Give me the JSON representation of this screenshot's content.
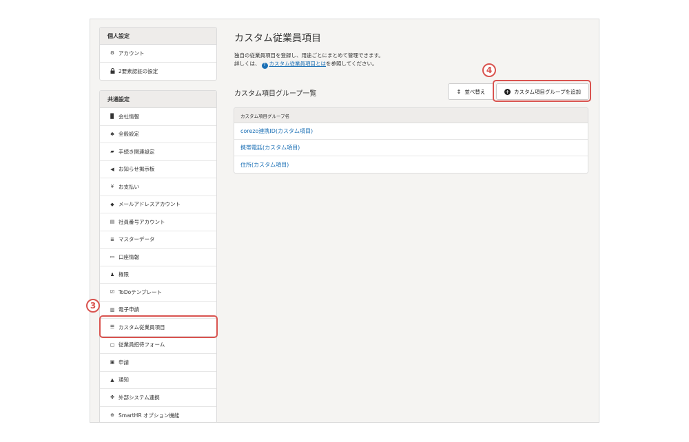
{
  "sidebar": {
    "personal": {
      "title": "個人設定",
      "items": [
        {
          "icon": "gear-icon",
          "glyph": "✿",
          "label": "アカウント"
        },
        {
          "icon": "lock-icon",
          "glyph": "🔒",
          "label": "2要素認証の設定"
        }
      ]
    },
    "common": {
      "title": "共通設定",
      "items": [
        {
          "icon": "building-icon",
          "glyph": "▉",
          "label": "会社情報"
        },
        {
          "icon": "star-icon",
          "glyph": "✱",
          "label": "全般設定"
        },
        {
          "icon": "procedure-icon",
          "glyph": "▰",
          "label": "手続き関連設定"
        },
        {
          "icon": "megaphone-icon",
          "glyph": "◀",
          "label": "お知らせ掲示板"
        },
        {
          "icon": "yen-icon",
          "glyph": "¥",
          "label": "お支払い"
        },
        {
          "icon": "users-icon",
          "glyph": "◆",
          "label": "メールアドレスアカウント"
        },
        {
          "icon": "id-card-icon",
          "glyph": "▤",
          "label": "社員番号アカウント"
        },
        {
          "icon": "database-icon",
          "glyph": "≣",
          "label": "マスターデータ"
        },
        {
          "icon": "card-icon",
          "glyph": "▭",
          "label": "口座情報"
        },
        {
          "icon": "user-icon",
          "glyph": "♟",
          "label": "権限"
        },
        {
          "icon": "checkbox-icon",
          "glyph": "☑",
          "label": "ToDoテンプレート"
        },
        {
          "icon": "bank-icon",
          "glyph": "▥",
          "label": "電子申請"
        },
        {
          "icon": "list-icon",
          "glyph": "☰",
          "label": "カスタム従業員項目"
        },
        {
          "icon": "form-icon",
          "glyph": "▢",
          "label": "従業員招待フォーム"
        },
        {
          "icon": "application-icon",
          "glyph": "▣",
          "label": "申請"
        },
        {
          "icon": "bell-icon",
          "glyph": "▲",
          "label": "通知"
        },
        {
          "icon": "link-icon",
          "glyph": "✤",
          "label": "外部システム連携"
        },
        {
          "icon": "plus-circle-icon",
          "glyph": "⊕",
          "label": "SmartHR オプション機能"
        }
      ]
    }
  },
  "main": {
    "title": "カスタム従業員項目",
    "desc_line1": "独自の従業員項目を登録し、用途ごとにまとめて管理できます。",
    "desc_line2_pre": "詳しくは、",
    "desc_link": "カスタム従業員項目とは",
    "desc_line2_post": "を参照してください。",
    "section_title": "カスタム項目グループ一覧",
    "sort_button": "並べ替え",
    "add_button": "カスタム項目グループを追加",
    "table": {
      "header": "カスタム項目グループ名",
      "rows": [
        "corezo連携ID(カスタム項目)",
        "携帯電話(カスタム項目)",
        "住所(カスタム項目)"
      ]
    }
  },
  "annotations": {
    "step3": "③",
    "step4": "④",
    "color": "#d9534f"
  }
}
